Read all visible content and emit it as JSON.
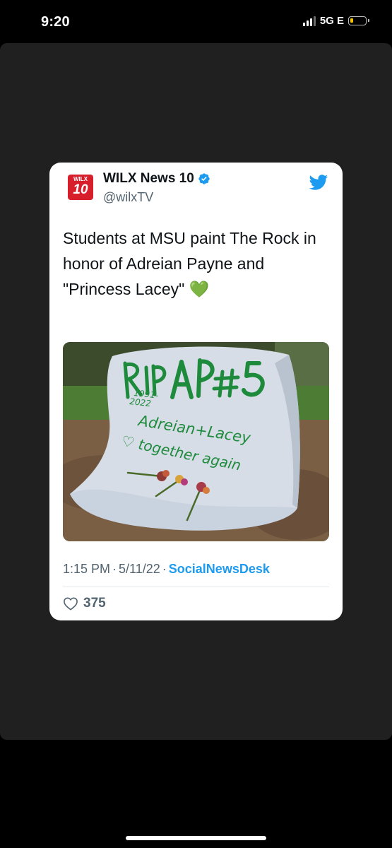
{
  "status_bar": {
    "time": "9:20",
    "network": "5G E",
    "battery_color": "#f7c600"
  },
  "tweet": {
    "avatar": {
      "top": "WILX",
      "number": "10"
    },
    "display_name": "WILX News 10",
    "handle": "@wilxTV",
    "text": "Students at MSU paint The Rock in honor of Adreian Payne and \"Princess Lacey\" 💚",
    "image": {
      "painted_lines": [
        "RIP AP#5",
        "1991-",
        "2022",
        "Adreian+Lacey",
        "♡ together again"
      ]
    },
    "time": "1:15 PM",
    "date": "5/11/22",
    "source": "SocialNewsDesk",
    "likes": "375",
    "colors": {
      "accent": "#1d9bf0",
      "avatar_red": "#d71f2b",
      "paint_green": "#1d8a3c"
    },
    "icons": [
      "verified-badge-icon",
      "twitter-bird-icon",
      "heart-icon"
    ]
  }
}
